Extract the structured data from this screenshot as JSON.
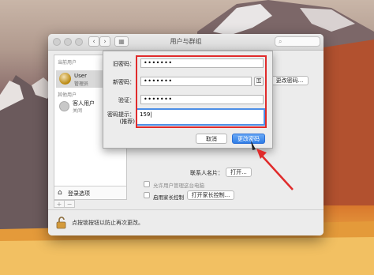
{
  "window": {
    "title": "用户与群组",
    "back_glyph": "‹",
    "forward_glyph": "›",
    "grid_glyph": "▦",
    "search_placeholder": ""
  },
  "sidebar": {
    "current_users_header": "当前用户",
    "current_user": {
      "name": "User",
      "role": "管理员"
    },
    "other_users_header": "其他用户",
    "guest": {
      "name": "客人用户",
      "status": "关闭"
    },
    "login_options": "登录选项",
    "home_icon": "⌂",
    "add_glyph": "+",
    "remove_glyph": "−"
  },
  "main": {
    "change_password_button": "更改密码...",
    "contacts_card_label": "联系人名片：",
    "open_button": "打开...",
    "allow_admin_label": "允许用户管理这台电脑",
    "parental_controls_label": "启用家长控制",
    "open_parental_button": "打开家长控制..."
  },
  "dialog": {
    "old_password_label": "旧密码：",
    "old_password_value": "•••••••",
    "new_password_label": "新密码：",
    "new_password_value": "•••••••",
    "verify_label": "验证：",
    "verify_value": "•••••••",
    "hint_label": "密码提示：",
    "hint_sub_label": "(推荐)",
    "hint_value": "159|",
    "key_icon_glyph": "⚿",
    "cancel_button": "取消",
    "change_password_button": "更改密码"
  },
  "lock": {
    "text": "点按锁按钮以防止再次更改。"
  },
  "colors": {
    "annotation_red": "#e02b2b",
    "accent_blue": "#2f7de6"
  }
}
